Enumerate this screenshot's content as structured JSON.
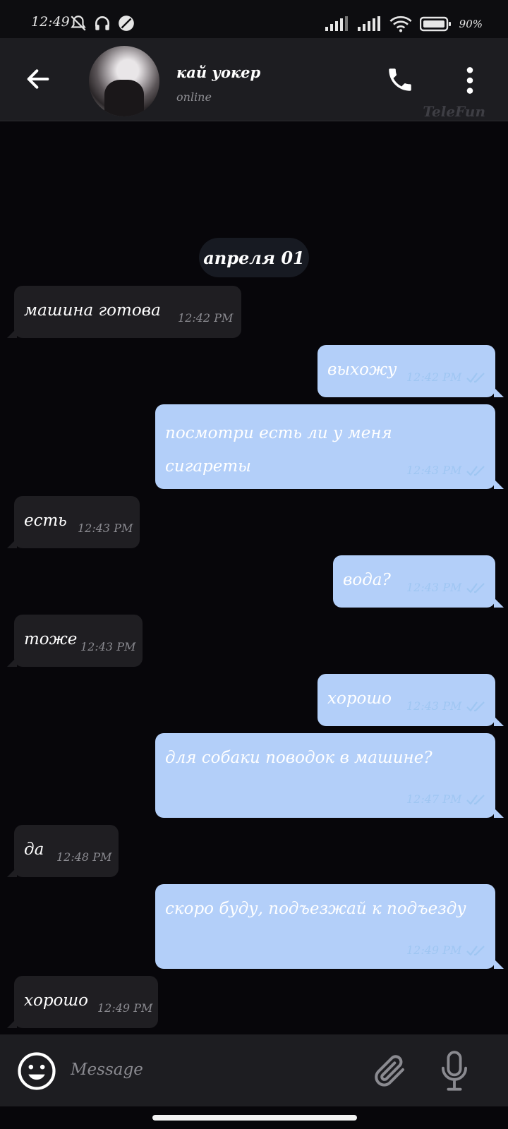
{
  "status_bar": {
    "time": "12:49",
    "battery": "90%",
    "icons": [
      "bell-off-icon",
      "headphones-icon",
      "dnd-icon",
      "signal-icon",
      "signal-icon",
      "wifi-icon",
      "battery-icon"
    ]
  },
  "header": {
    "name": "кай уокер",
    "status": "online",
    "watermark": "TeleFun",
    "icons": [
      "back-arrow-icon",
      "phone-icon",
      "more-vert-icon"
    ]
  },
  "date_label": "апреля 01",
  "messages": [
    {
      "dir": "in",
      "text": "машина готова",
      "time": "12:42 PM"
    },
    {
      "dir": "out",
      "text": "выхожу",
      "time": "12:42 PM",
      "read": true
    },
    {
      "dir": "out",
      "text": "посмотри есть ли у меня сигареты",
      "time": "12:43 PM",
      "read": true
    },
    {
      "dir": "in",
      "text": "есть",
      "time": "12:43 PM"
    },
    {
      "dir": "out",
      "text": "вода?",
      "time": "12:43 PM",
      "read": true
    },
    {
      "dir": "in",
      "text": "тоже",
      "time": "12:43 PM"
    },
    {
      "dir": "out",
      "text": "хорошо",
      "time": "12:43 PM",
      "read": true
    },
    {
      "dir": "out",
      "text": "для собаки поводок в машине?",
      "time": "12:47 PM",
      "read": true
    },
    {
      "dir": "in",
      "text": "да",
      "time": "12:48 PM"
    },
    {
      "dir": "out",
      "text": "скоро буду, подъезжай к подъезду",
      "time": "12:49 PM",
      "read": true
    },
    {
      "dir": "in",
      "text": "хорошо",
      "time": "12:49 PM"
    }
  ],
  "composer": {
    "placeholder": "Message",
    "icons": [
      "emoji-icon",
      "paperclip-icon",
      "microphone-icon"
    ]
  },
  "colors": {
    "background": "#07060a",
    "header": "#1d1d21",
    "incoming_bubble": "#1f1e22",
    "outgoing_bubble": "#b3cff9",
    "outgoing_meta": "#9fc6f2",
    "incoming_meta": "#8a8a90"
  }
}
